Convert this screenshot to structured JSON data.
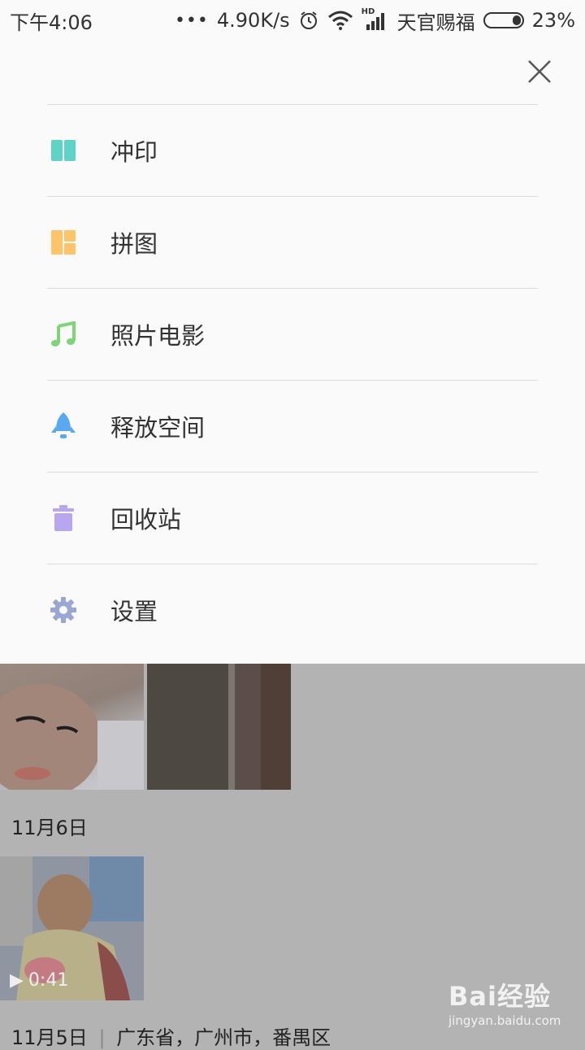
{
  "status_bar": {
    "time": "下午4:06",
    "speed": "4.90K/s",
    "network_badge": "HD",
    "carrier": "天官赐福",
    "battery": "23%",
    "battery_level": 0.23
  },
  "menu": {
    "items": [
      {
        "label": "冲印",
        "icon": "print-icon",
        "color": "#5fd3c6"
      },
      {
        "label": "拼图",
        "icon": "collage-icon",
        "color": "#ffc469"
      },
      {
        "label": "照片电影",
        "icon": "music-note-icon",
        "color": "#7fd37a"
      },
      {
        "label": "释放空间",
        "icon": "rocket-icon",
        "color": "#5aa9f0"
      },
      {
        "label": "回收站",
        "icon": "trash-icon",
        "color": "#b8a6ee"
      },
      {
        "label": "设置",
        "icon": "gear-icon",
        "color": "#9aa7d3"
      }
    ]
  },
  "gallery": {
    "date_1": "11月6日",
    "video_duration": "0:41",
    "date_2": "11月5日",
    "location_2": "广东省，广州市，番禺区"
  },
  "watermark": {
    "brand": "Bai经验",
    "site": "jingyan.baidu.com"
  }
}
